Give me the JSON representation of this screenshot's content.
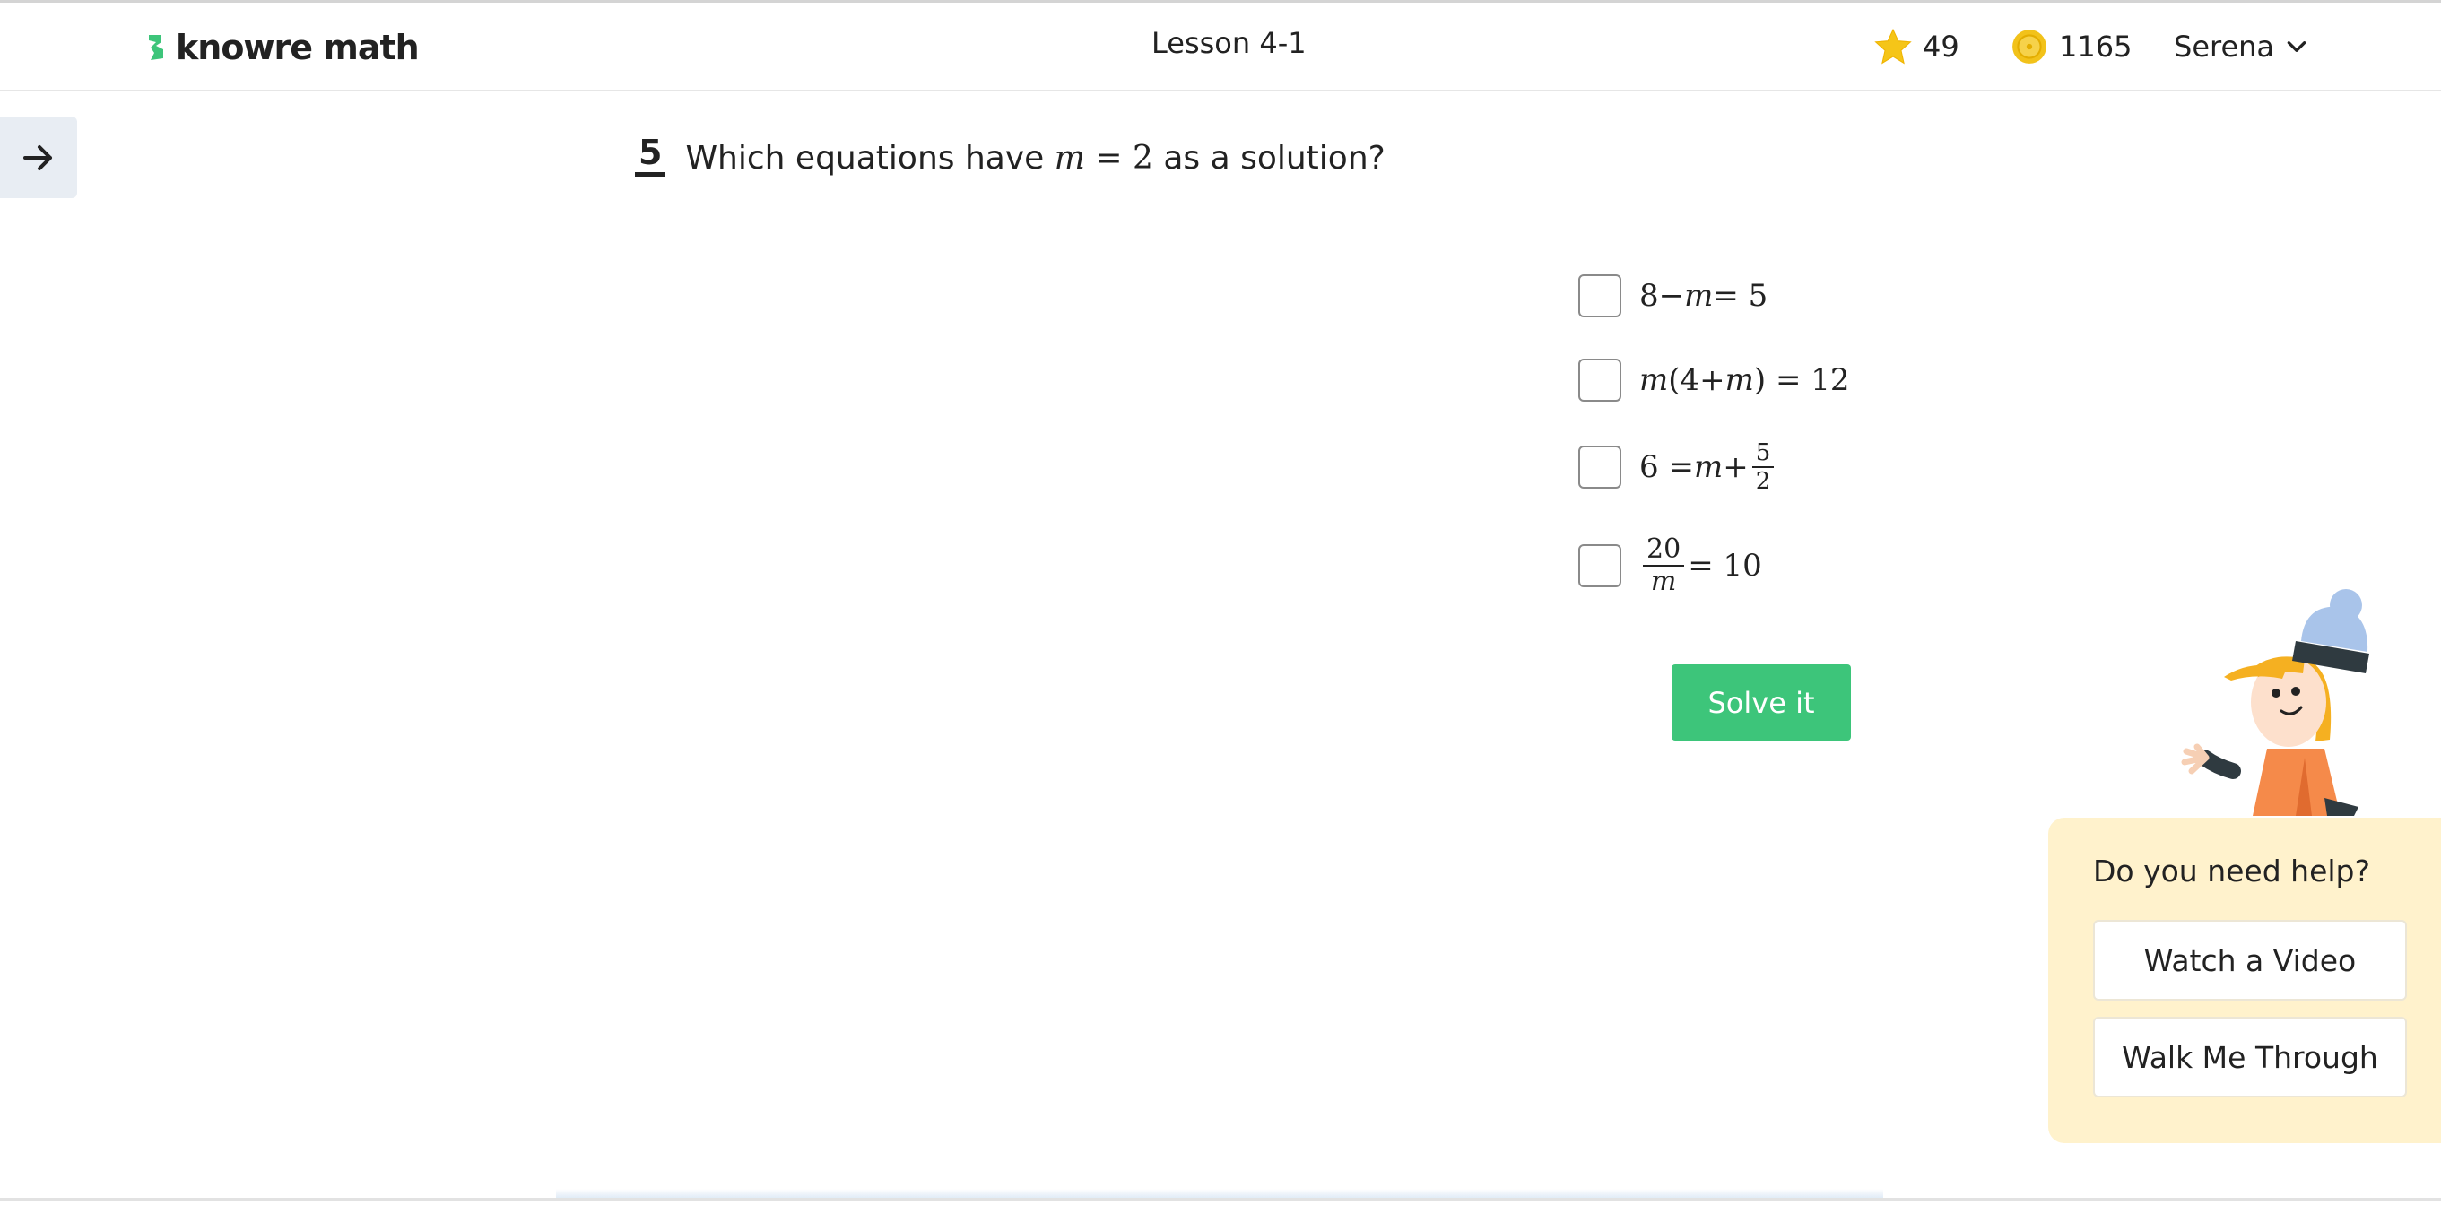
{
  "header": {
    "logo_text": "knowre math",
    "lesson_title": "Lesson 4-1",
    "stars": "49",
    "coins": "1165",
    "user_name": "Serena"
  },
  "question": {
    "number": "5",
    "text_before": "Which equations have",
    "math_var": "m",
    "math_rest": " = 2",
    "text_after": "as a solution?"
  },
  "choices": [
    {
      "a": "8",
      "op1": "−",
      "var": "m",
      "rest": " = 5"
    },
    {
      "var": "m",
      "mid": "(4+",
      "var2": "m",
      "rest": ") = 12"
    },
    {
      "a": "6 = ",
      "var": "m",
      "op": "+",
      "num": "5",
      "den": "2"
    },
    {
      "num": "20",
      "den": "m",
      "rest": " = 10"
    }
  ],
  "actions": {
    "solve_label": "Solve it"
  },
  "help": {
    "title": "Do you need help?",
    "video_label": "Watch a Video",
    "walk_label": "Walk Me Through"
  },
  "colors": {
    "accent_green": "#3dc57a",
    "help_bg": "#fff2cc",
    "side_toggle_bg": "#e8edf3",
    "star": "#f5c518",
    "coin": "#f2c21a"
  },
  "icons": {
    "logo": "knowre-logo-icon",
    "star": "star-icon",
    "coin": "coin-icon",
    "user_dropdown": "chevron-down-icon",
    "side_toggle": "arrow-right-icon"
  }
}
